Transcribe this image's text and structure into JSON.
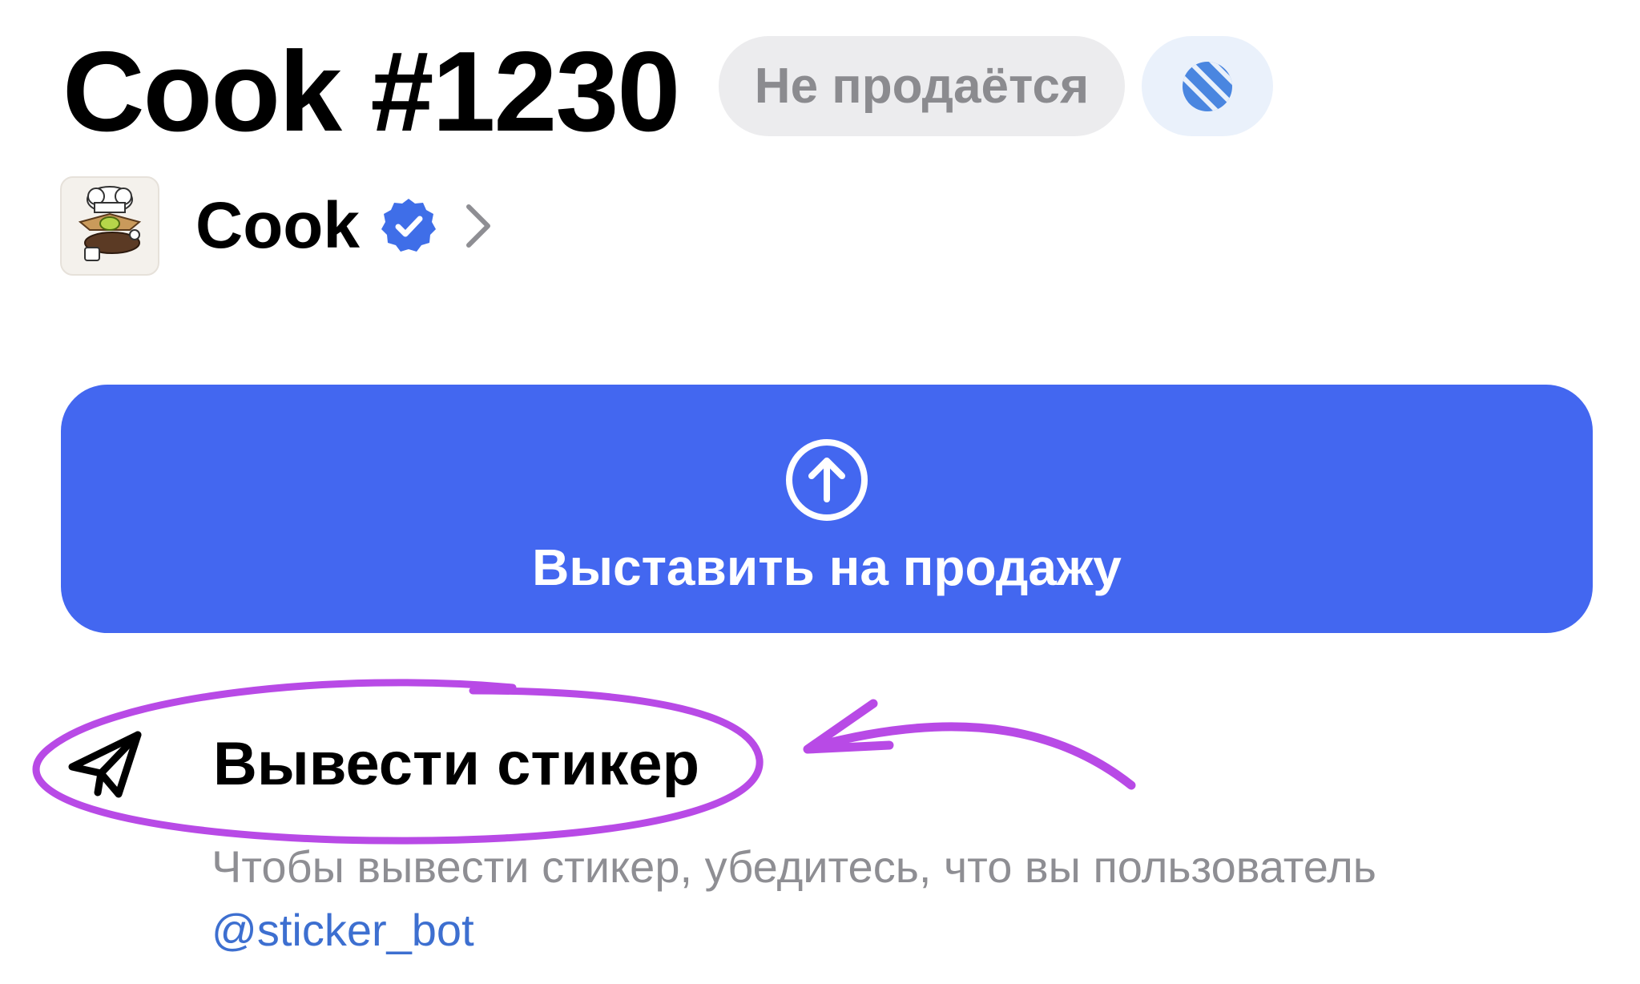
{
  "header": {
    "title": "Cook #1230",
    "status": "Не продаётся"
  },
  "collection": {
    "name": "Cook",
    "verified": true
  },
  "actions": {
    "sell_label": "Выставить на продажу",
    "withdraw_label": "Вывести стикер"
  },
  "hint": {
    "text": "Чтобы вывести стикер, убедитесь, что вы пользователь",
    "link": "@sticker_bot"
  },
  "icons": {
    "status_toggle": "strikethrough-circle-icon",
    "verified": "verified-badge-icon",
    "chevron": "chevron-right-icon",
    "sell": "upload-arrow-circle-icon",
    "withdraw": "telegram-send-icon"
  },
  "colors": {
    "accent": "#4367f0",
    "verified": "#3f6ee8",
    "link": "#3d6fd0",
    "muted_text": "#8e8e93",
    "pill_bg": "#ececee",
    "annotation": "#b84ae6"
  }
}
